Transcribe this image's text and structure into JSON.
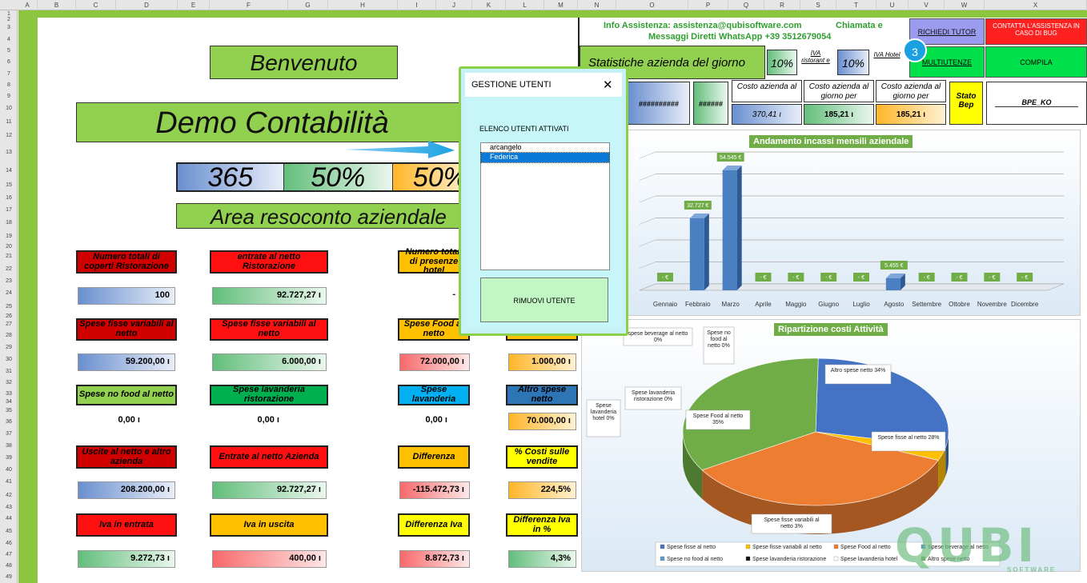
{
  "columns": [
    "A",
    "B",
    "C",
    "D",
    "E",
    "F",
    "G",
    "H",
    "I",
    "J",
    "K",
    "L",
    "M",
    "N",
    "O",
    "P",
    "Q",
    "R",
    "S",
    "T",
    "U",
    "V",
    "W",
    "X"
  ],
  "rows": [
    "1",
    "2",
    "3",
    "4",
    "5",
    "6",
    "7",
    "8",
    "9",
    "10",
    "11",
    "12",
    "13",
    "14",
    "15",
    "16",
    "17",
    "18",
    "19",
    "20",
    "21",
    "22",
    "23",
    "24",
    "25",
    "26",
    "27",
    "28",
    "29",
    "30",
    "31",
    "32",
    "33",
    "34",
    "35",
    "36",
    "37",
    "38",
    "39",
    "40",
    "41",
    "42",
    "43",
    "44",
    "45",
    "46",
    "47",
    "48",
    "49"
  ],
  "header": {
    "welcome": "Benvenuto",
    "title": "Demo Contabilità",
    "kpi": [
      "365",
      "50%",
      "50%"
    ],
    "area": "Area resoconto aziendale"
  },
  "info": {
    "line1": "Info Assistenza: assistenza@qubisoftware.com",
    "line1b": "Chiamata e",
    "line2": "Messaggi Diretti WhatsApp  +39 3512679054",
    "stats": "Statistiche azienda del giorno",
    "iva1": "10%",
    "iva_rist": "IVA ristorant e",
    "iva2": "10%",
    "iva_hotel": "IVA Hotel",
    "tutor": "RICHIEDI TUTOR",
    "contact": "CONTATTA L'ASSISTENZA IN CASO DI BUG",
    "multi": "MULTIUTENZE",
    "compila": "COMPILA",
    "badge": "3",
    "hashes1": "##########",
    "hashes2": "######",
    "costo_al": "Costo azienda al",
    "costo_al_val": "370,41 ı",
    "costo_per": "Costo azienda al giorno per",
    "costo_per_val": "185,21 ı",
    "costo_per2": "Costo azienda al giorno per",
    "costo_per2_val": "185,21 ı",
    "stato": "Stato Bep",
    "bpe": "BPE_KO"
  },
  "grid": [
    {
      "label": "Numero totali di coperti Ristorazione",
      "value": "100"
    },
    {
      "label": "entrate al netto Ristorazione",
      "value": "92.727,27 ı"
    },
    {
      "label": "Numero totali di presenze hotel",
      "value": "-"
    },
    {
      "label": "Spese fisse variabili al netto",
      "value": "59.200,00 ı"
    },
    {
      "label": "Spese fisse variabili al netto",
      "value": "6.000,00 ı"
    },
    {
      "label": "Spese Food al netto",
      "value": "72.000,00 ı"
    },
    {
      "label": "beverage al",
      "value": "1.000,00 ı"
    },
    {
      "label": "Spese no food al netto",
      "value": "0,00 ı"
    },
    {
      "label": "Spese lavanderia ristorazione",
      "value": "0,00 ı"
    },
    {
      "label": "Spese lavanderia",
      "value": "0,00 ı"
    },
    {
      "label": "Altro spese netto",
      "value": "70.000,00 ı"
    },
    {
      "label": "Uscite al netto e altro azienda",
      "value": "208.200,00 ı"
    },
    {
      "label": "Entrate al netto Azienda",
      "value": "92.727,27 ı"
    },
    {
      "label": "Differenza",
      "value": "-115.472,73 ı"
    },
    {
      "label": "% Costi sulle vendite",
      "value": "224,5%"
    },
    {
      "label": "Iva in entrata",
      "value": "9.272,73 ı"
    },
    {
      "label": "Iva in uscita",
      "value": "400,00 ı"
    },
    {
      "label": "Differenza Iva",
      "value": "8.872,73 ı"
    },
    {
      "label": "Differenza Iva in %",
      "value": "4,3%"
    }
  ],
  "dialog": {
    "title": "GESTIONE UTENTI",
    "close": "✕",
    "list_label": "ELENCO UTENTI ATTIVATI",
    "users": [
      "arcangelo",
      "Federica"
    ],
    "remove": "RIMUOVI UTENTE"
  },
  "logo": {
    "text": "QUBI",
    "sub": "SOFTWARE"
  },
  "chart_data": [
    {
      "type": "bar",
      "title": "Andamento incassi mensili aziendale",
      "categories": [
        "Gennaio",
        "Febbraio",
        "Marzo",
        "Aprile",
        "Maggio",
        "Giugno",
        "Luglio",
        "Agosto",
        "Settembre",
        "Ottobre",
        "Novembre",
        "Dicembre"
      ],
      "values": [
        0,
        32727,
        54545,
        0,
        0,
        0,
        0,
        5455,
        0,
        0,
        0,
        0
      ],
      "labels": [
        "- €",
        "32.727 €",
        "54.545 €",
        "- €",
        "- €",
        "- €",
        "- €",
        "5.455 €",
        "- €",
        "- €",
        "- €",
        "- €"
      ]
    },
    {
      "type": "pie",
      "title": "Ripartizione costi Attività",
      "slices": [
        {
          "name": "Spese fisse al netto",
          "value": 28,
          "label": "Spese fisse al netto 28%",
          "color": "#4472c4"
        },
        {
          "name": "Spese fisse variabili al netto",
          "value": 3,
          "label": "Spese fisse variabili al netto 3%",
          "color": "#ffc000"
        },
        {
          "name": "Spese Food al netto",
          "value": 35,
          "label": "Spese Food al netto 35%",
          "color": "#ed7d31"
        },
        {
          "name": "Spese beverage al netto",
          "value": 0,
          "label": "spese beverage al netto 0%",
          "color": "#5b9bd5"
        },
        {
          "name": "Spese no food al netto",
          "value": 0,
          "label": "Spese no food al netto 0%",
          "color": "#5b9bd5"
        },
        {
          "name": "Spese lavanderia ristorazione",
          "value": 0,
          "label": "Spese lavanderia ristorazione 0%",
          "color": "#111111"
        },
        {
          "name": "Spese lavanderia hotel",
          "value": 0,
          "label": "Spese lavanderia hotel 0%",
          "color": "#ffffff"
        },
        {
          "name": "Altro spese netto",
          "value": 34,
          "label": "Altro spese netto 34%",
          "color": "#70ad47"
        }
      ]
    }
  ]
}
